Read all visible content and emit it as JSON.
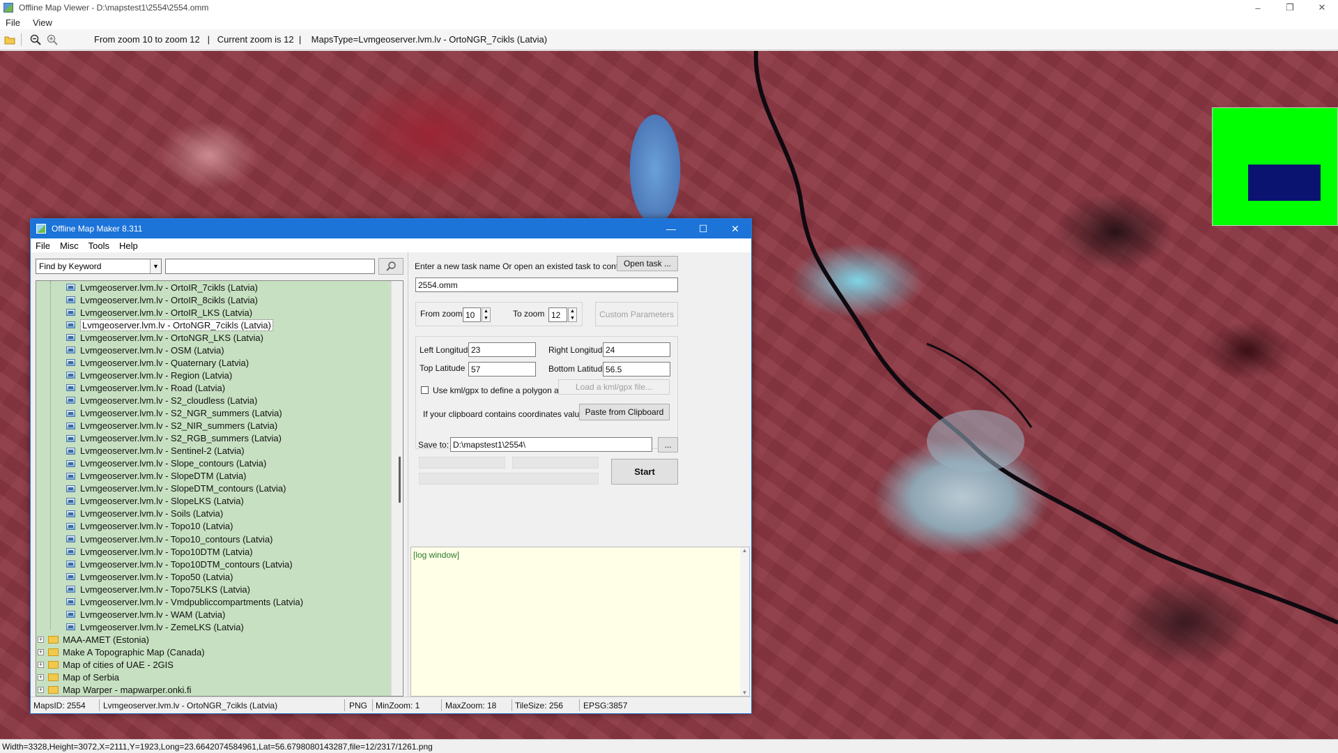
{
  "viewer": {
    "title": "Offline Map Viewer - D:\\mapstest1\\2554\\2554.omm",
    "menu": [
      "File",
      "View"
    ],
    "toolbar_icons": [
      "open-folder-icon",
      "zoom-out-icon",
      "zoom-in-icon"
    ],
    "info": "From zoom 10 to zoom 12   |   Current zoom is 12  |    MapsType=Lvmgeoserver.lvm.lv - OrtoNGR_7cikls (Latvia)",
    "status": "Width=3328,Height=3072,X=2111,Y=1923,Long=23.6642074584961,Lat=56.6798080143287,file=12/2317/1261.png",
    "window_controls": [
      "–",
      "❐",
      "✕"
    ]
  },
  "dialog": {
    "title": "Offline Map Maker 8.311",
    "menu": [
      "File",
      "Misc",
      "Tools",
      "Help"
    ],
    "find": {
      "selected": "Find by Keyword",
      "value": ""
    },
    "tree_items": [
      "Lvmgeoserver.lvm.lv - OrtoIR_7cikls (Latvia)",
      "Lvmgeoserver.lvm.lv - OrtoIR_8cikls (Latvia)",
      "Lvmgeoserver.lvm.lv - OrtoIR_LKS (Latvia)",
      "Lvmgeoserver.lvm.lv - OrtoNGR_7cikls (Latvia)",
      "Lvmgeoserver.lvm.lv - OrtoNGR_LKS (Latvia)",
      "Lvmgeoserver.lvm.lv - OSM (Latvia)",
      "Lvmgeoserver.lvm.lv - Quaternary (Latvia)",
      "Lvmgeoserver.lvm.lv - Region (Latvia)",
      "Lvmgeoserver.lvm.lv - Road (Latvia)",
      "Lvmgeoserver.lvm.lv - S2_cloudless (Latvia)",
      "Lvmgeoserver.lvm.lv - S2_NGR_summers (Latvia)",
      "Lvmgeoserver.lvm.lv - S2_NIR_summers (Latvia)",
      "Lvmgeoserver.lvm.lv - S2_RGB_summers (Latvia)",
      "Lvmgeoserver.lvm.lv - Sentinel-2 (Latvia)",
      "Lvmgeoserver.lvm.lv - Slope_contours (Latvia)",
      "Lvmgeoserver.lvm.lv - SlopeDTM (Latvia)",
      "Lvmgeoserver.lvm.lv - SlopeDTM_contours (Latvia)",
      "Lvmgeoserver.lvm.lv - SlopeLKS (Latvia)",
      "Lvmgeoserver.lvm.lv - Soils (Latvia)",
      "Lvmgeoserver.lvm.lv - Topo10 (Latvia)",
      "Lvmgeoserver.lvm.lv - Topo10_contours (Latvia)",
      "Lvmgeoserver.lvm.lv - Topo10DTM (Latvia)",
      "Lvmgeoserver.lvm.lv - Topo10DTM_contours (Latvia)",
      "Lvmgeoserver.lvm.lv - Topo50 (Latvia)",
      "Lvmgeoserver.lvm.lv - Topo75LKS (Latvia)",
      "Lvmgeoserver.lvm.lv - Vmdpubliccompartments (Latvia)",
      "Lvmgeoserver.lvm.lv - WAM (Latvia)",
      "Lvmgeoserver.lvm.lv - ZemeLKS (Latvia)"
    ],
    "tree_selected": "Lvmgeoserver.lvm.lv - OrtoNGR_7cikls (Latvia)",
    "tree_folders": [
      "MAA-AMET (Estonia)",
      "Make A Topographic Map (Canada)",
      "Map of cities of UAE - 2GIS",
      "Map of Serbia",
      "Map Warper - mapwarper.onki.fi"
    ],
    "task_prompt": "Enter a new task name Or open an existed task to continue:",
    "open_task": "Open task ...",
    "task_name": "2554.omm",
    "from_zoom_label": "From zoom",
    "from_zoom": "10",
    "to_zoom_label": "To zoom",
    "to_zoom": "12",
    "custom_params": "Custom Parameters",
    "left_lon_label": "Left Longitude",
    "left_lon": "23",
    "right_lon_label": "Right Longitude",
    "right_lon": "24",
    "top_lat_label": "Top Latitude",
    "top_lat": "57",
    "bottom_lat_label": "Bottom Latitude",
    "bottom_lat": "56.5",
    "kml_label": "Use kml/gpx to define a polygon area",
    "kml_checked": false,
    "load_kml": "Load a kml/gpx file...",
    "clipboard_label": "If your clipboard contains coordinates values:",
    "paste": "Paste from Clipboard",
    "save_to_label": "Save to:",
    "save_to": "D:\\mapstest1\\2554\\",
    "browse": "...",
    "start": "Start",
    "log": "[log window]",
    "status": {
      "maps_id": "MapsID: 2554",
      "name": "Lvmgeoserver.lvm.lv - OrtoNGR_7cikls (Latvia)",
      "format": "PNG",
      "min_zoom": "MinZoom: 1",
      "max_zoom": "MaxZoom: 18",
      "tile_size": "TileSize: 256",
      "epsg": "EPSG:3857"
    },
    "window_controls": [
      "—",
      "☐",
      "✕"
    ]
  },
  "colors": {
    "dialog_title": "#1c74d9",
    "tree_bg": "#c7e0c1",
    "minimap_bg": "#00ff00",
    "minimap_rect": "#0a1470"
  }
}
